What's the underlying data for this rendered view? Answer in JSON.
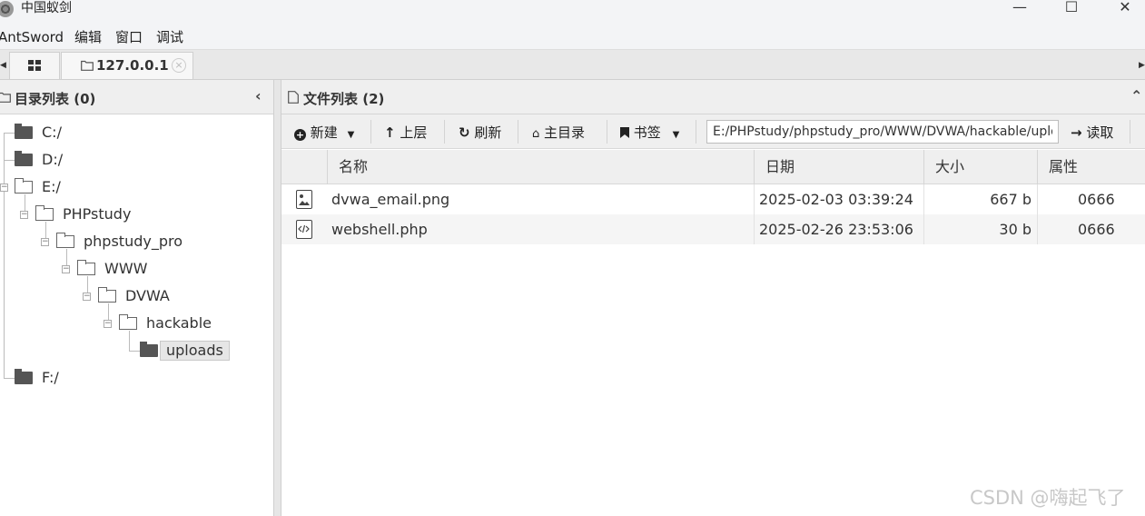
{
  "window": {
    "title": "中国蚁剑",
    "minimize_glyph": "—",
    "maximize_glyph": "☐",
    "close_glyph": "✕"
  },
  "menu": {
    "items": [
      "AntSword",
      "编辑",
      "窗口",
      "调试"
    ]
  },
  "tabs": {
    "host_label": "127.0.0.1",
    "close_glyph": "×"
  },
  "dir_panel": {
    "title": "目录列表 (0)",
    "collapse_glyph": "‹"
  },
  "tree": [
    {
      "label": "C:/",
      "expanded": false
    },
    {
      "label": "D:/",
      "expanded": false
    },
    {
      "label": "E:/",
      "expanded": true
    },
    {
      "label": "PHPstudy",
      "expanded": true
    },
    {
      "label": "phpstudy_pro",
      "expanded": true
    },
    {
      "label": "WWW",
      "expanded": true
    },
    {
      "label": "DVWA",
      "expanded": true
    },
    {
      "label": "hackable",
      "expanded": true
    },
    {
      "label": "uploads",
      "expanded": false,
      "selected": true
    },
    {
      "label": "F:/",
      "expanded": false
    }
  ],
  "file_panel": {
    "title": "文件列表 (2)",
    "collapse_glyph": "⌃"
  },
  "toolbar": {
    "new_label": "新建",
    "up_label": "上层",
    "refresh_label": "刷新",
    "home_label": "主目录",
    "bookmark_label": "书签",
    "path_value": "E:/PHPstudy/phpstudy_pro/WWW/DVWA/hackable/uploads/",
    "read_label": "读取"
  },
  "grid": {
    "columns": [
      "名称",
      "日期",
      "大小",
      "属性"
    ],
    "rows": [
      {
        "name": "dvwa_email.png",
        "date": "2025-02-03 03:39:24",
        "size": "667 b",
        "attr": "0666",
        "icon": "image-file-icon"
      },
      {
        "name": "webshell.php",
        "date": "2025-02-26 23:53:06",
        "size": "30 b",
        "attr": "0666",
        "icon": "code-file-icon"
      }
    ]
  },
  "watermark": "CSDN @嗨起飞了"
}
